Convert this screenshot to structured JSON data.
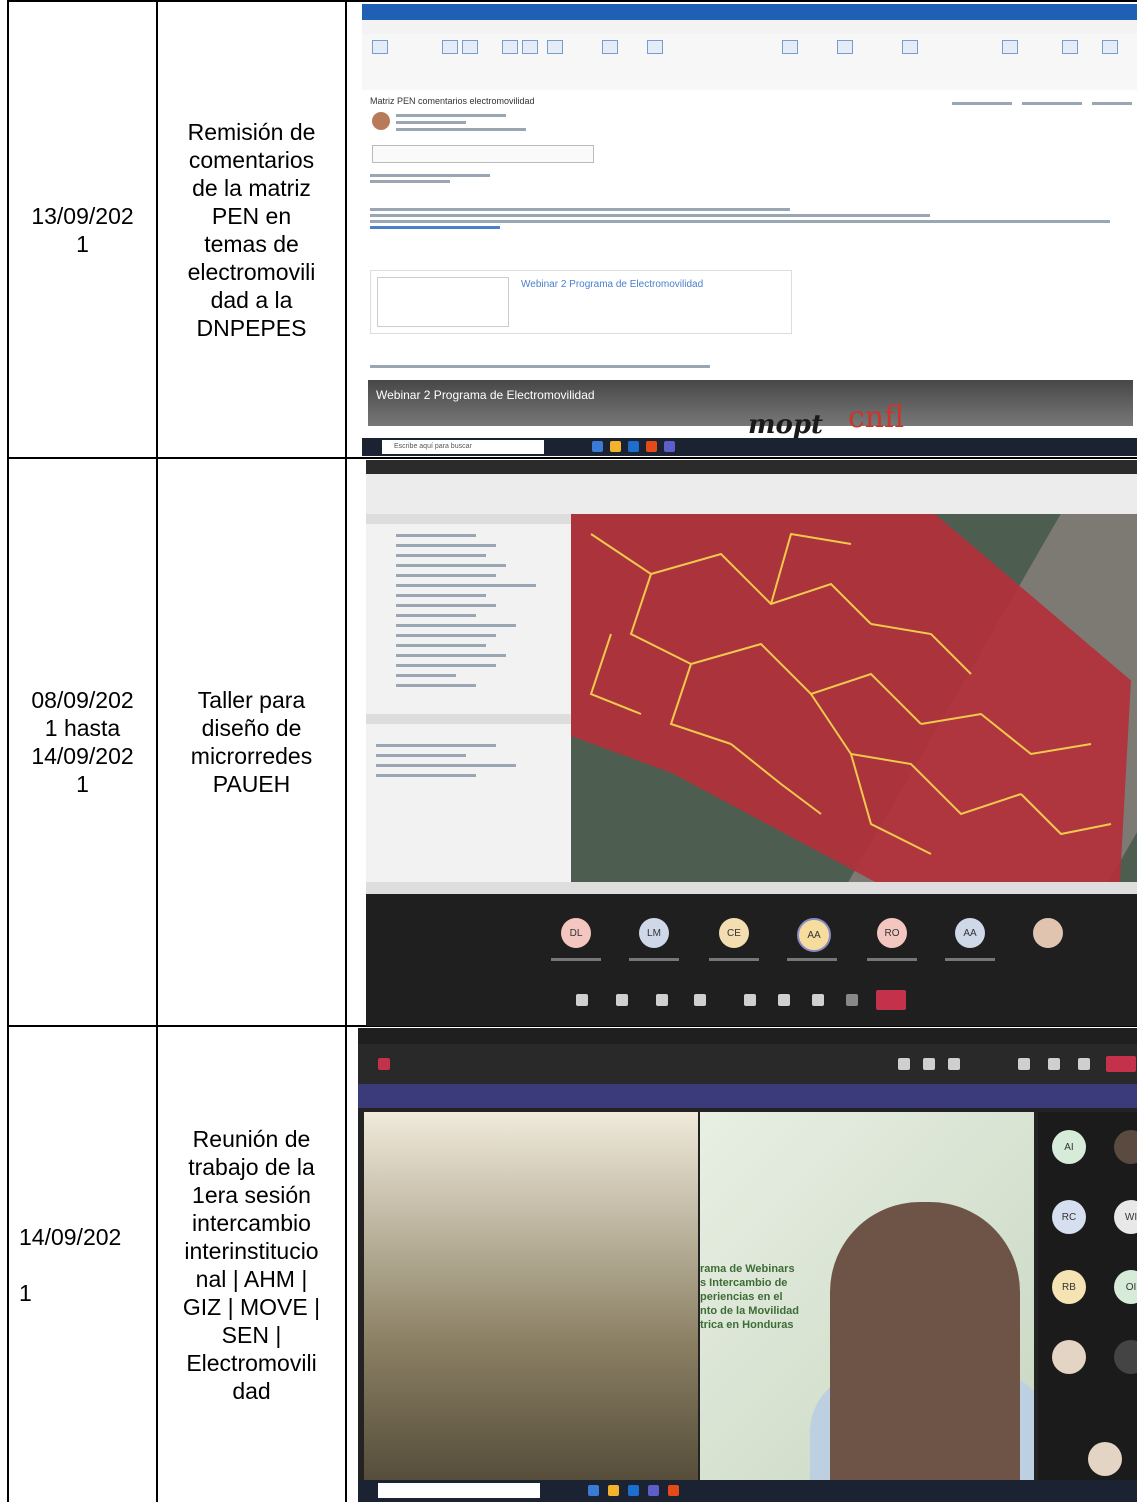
{
  "rows": [
    {
      "date": "13/09/202\n1",
      "description": "Remisión de\ncomentarios\nde la matriz\nPEN en\ntemas de\nelectromovili\ndad a la\nDNPEPES",
      "screenshot": {
        "app": "Outlook",
        "subject": "Matriz PEN comentarios electromovilidad",
        "video_title": "Webinar 2 Programa de Electromovilidad",
        "logo_left": "mopt",
        "logo_right": "cnfl",
        "taskbar_search": "Escribe aquí para buscar"
      }
    },
    {
      "date": "08/09/202\n1 hasta\n14/09/202\n1",
      "description": "Taller para\ndiseño de\nmicrorredes\nPAUEH",
      "screenshot": {
        "app": "QGIS / Teams",
        "participants": [
          "DL",
          "LM",
          "CE",
          "AA",
          "RO",
          "AA"
        ]
      }
    },
    {
      "date": "14/09/202\n\n1",
      "description": "Reunión de\ntrabajo de la\n1era sesión\nintercambio\ninterinstitucio\nnal | AHM |\nGIZ | MOVE |\nSEN |\nElectromovili\ndad",
      "screenshot": {
        "app": "Teams meeting",
        "slide_text": "rama de Webinars\ns Intercambio de\nperiencias en el\nnto de la Movilidad\ntrica en Honduras",
        "side_participants": [
          "AI",
          "RC",
          "RB",
          "WI",
          "OI"
        ]
      }
    }
  ],
  "colors": {
    "outlook_blue": "#1f5fb5",
    "map_red": "#b3303b",
    "teams_purple": "#3b3a7a"
  }
}
